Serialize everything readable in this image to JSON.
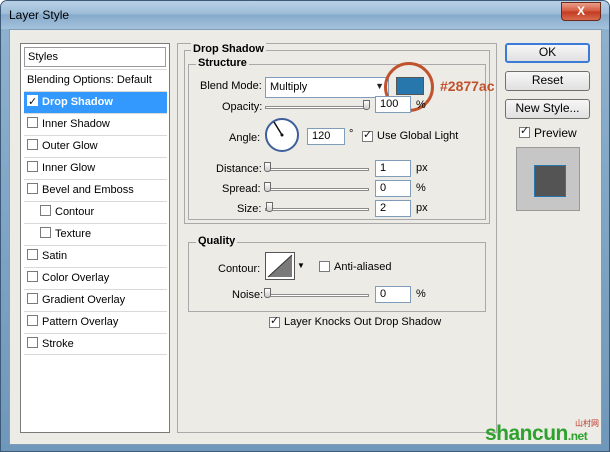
{
  "window": {
    "title": "Layer Style",
    "close_label": "X"
  },
  "styles_list": {
    "header": "Styles",
    "blending_options": "Blending Options: Default",
    "items": [
      {
        "label": "Drop Shadow",
        "checked": true,
        "selected": true
      },
      {
        "label": "Inner Shadow",
        "checked": false
      },
      {
        "label": "Outer Glow",
        "checked": false
      },
      {
        "label": "Inner Glow",
        "checked": false
      },
      {
        "label": "Bevel and Emboss",
        "checked": false
      },
      {
        "label": "Contour",
        "checked": false
      },
      {
        "label": "Texture",
        "checked": false
      },
      {
        "label": "Satin",
        "checked": false
      },
      {
        "label": "Color Overlay",
        "checked": false
      },
      {
        "label": "Gradient Overlay",
        "checked": false
      },
      {
        "label": "Pattern Overlay",
        "checked": false
      },
      {
        "label": "Stroke",
        "checked": false
      }
    ]
  },
  "drop_shadow": {
    "section_title": "Drop Shadow",
    "structure": {
      "title": "Structure",
      "blend_mode_label": "Blend Mode:",
      "blend_mode_value": "Multiply",
      "shadow_color": "#2877ac",
      "shadow_color_annotation": "#2877ac",
      "opacity_label": "Opacity:",
      "opacity_value": "100",
      "opacity_unit": "%",
      "opacity_fraction": 1.0,
      "angle_label": "Angle:",
      "angle_value": "120",
      "angle_unit": "°",
      "use_global_light_label": "Use Global Light",
      "use_global_light_checked": true,
      "distance_label": "Distance:",
      "distance_value": "1",
      "distance_unit": "px",
      "spread_label": "Spread:",
      "spread_value": "0",
      "spread_unit": "%",
      "size_label": "Size:",
      "size_value": "2",
      "size_unit": "px"
    },
    "quality": {
      "title": "Quality",
      "contour_label": "Contour:",
      "anti_aliased_label": "Anti-aliased",
      "anti_aliased_checked": false,
      "noise_label": "Noise:",
      "noise_value": "0",
      "noise_unit": "%"
    },
    "layer_knocks_out_label": "Layer Knocks Out Drop Shadow",
    "layer_knocks_out_checked": true
  },
  "buttons": {
    "ok": "OK",
    "reset": "Reset",
    "new_style": "New Style...",
    "preview_label": "Preview",
    "preview_checked": true
  },
  "watermark": {
    "text": "shancun",
    "suffix": ".net",
    "sub": "山村网"
  }
}
